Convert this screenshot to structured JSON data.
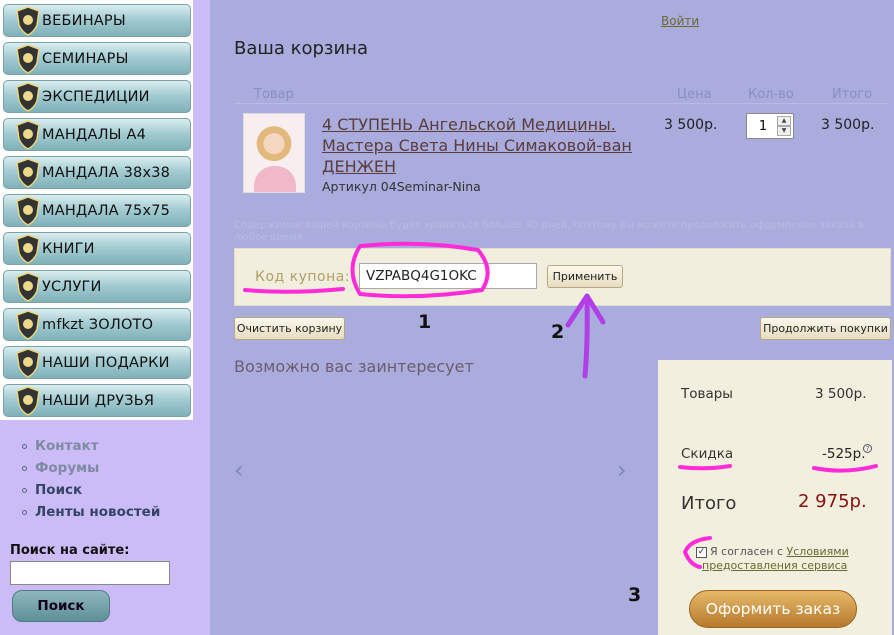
{
  "sidebar": {
    "menu": [
      {
        "label": "ВЕБИНАРЫ"
      },
      {
        "label": "СЕМИНАРЫ"
      },
      {
        "label": "ЭКСПЕДИЦИИ"
      },
      {
        "label": "МАНДАЛЫ А4"
      },
      {
        "label": "МАНДАЛА 38x38"
      },
      {
        "label": "МАНДАЛА 75x75"
      },
      {
        "label": "КНИГИ"
      },
      {
        "label": "УСЛУГИ"
      },
      {
        "label": "mfkzt ЗОЛОТО"
      },
      {
        "label": "НАШИ ПОДАРКИ"
      },
      {
        "label": "НАШИ ДРУЗЬЯ"
      }
    ],
    "links": [
      "Контакт",
      "Форумы",
      "Поиск",
      "Ленты новостей"
    ],
    "search_label": "Поиск на сайте:",
    "search_button": "Поиск"
  },
  "header": {
    "login": "Войти",
    "cart_title": "Ваша корзина"
  },
  "table": {
    "columns": [
      "Товар",
      "Цена",
      "Кол-во",
      "Итого"
    ],
    "item": {
      "name": "4 СТУПЕНЬ Ангельской Медицины. Мастера Света Нины Симаковой-ван ДЕНЖЕН",
      "sku": "Артикул 04Seminar-Nina",
      "price": "3 500р.",
      "qty": "1",
      "total": "3 500р."
    }
  },
  "notice": "Содержимое вашей корзины будет храниться больше 30 дней, поэтому вы можете продолжить оформление заказа в любое время.",
  "coupon": {
    "label": "Код купона:",
    "value": "VZPABQ4G1OKC",
    "apply": "Применить"
  },
  "buttons": {
    "clear": "Очистить корзину",
    "continue": "Продолжить покупки"
  },
  "recommend": {
    "title": "Возможно вас заинтересует"
  },
  "summary": {
    "goods_label": "Товары",
    "goods_value": "3 500р.",
    "discount_label": "Скидка",
    "discount_value": "-525р.",
    "total_label": "Итого",
    "total_value": "2 975р.",
    "agree_text": "Я согласен с",
    "agree_link_1": "Условиями",
    "agree_link_2": "предоставления сервиса",
    "checkout": "Оформить заказ"
  },
  "annotations": {
    "n1": "1",
    "n2": "2",
    "n3": "3"
  },
  "colors": {
    "main_bg": "#a9acdd",
    "sidebar_bg": "#cbbcf7",
    "panel_bg": "#f2eedd",
    "total_red": "#8b1010",
    "highlighter_pink": "#ff2bd8",
    "highlighter_violet": "#b23ee8"
  }
}
